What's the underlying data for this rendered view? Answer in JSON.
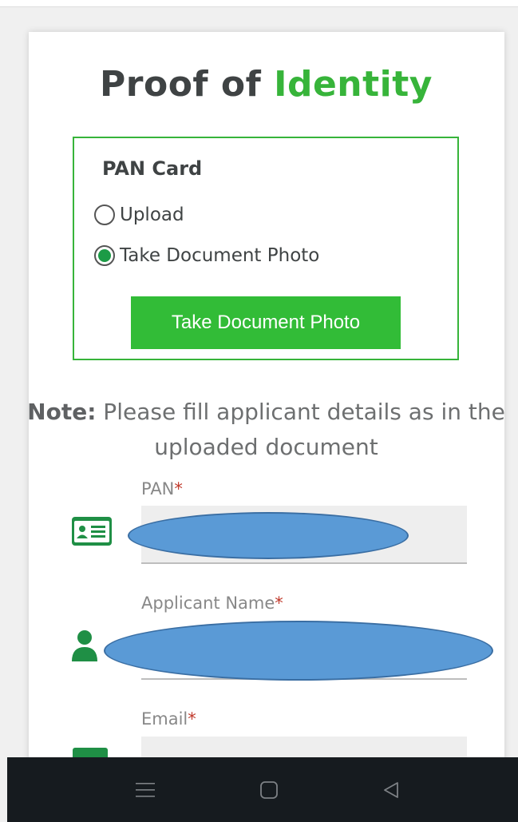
{
  "page": {
    "title_part1": "Proof of ",
    "title_part2": "Identity"
  },
  "pan_card": {
    "heading": "PAN Card",
    "options": [
      {
        "label": "Upload",
        "selected": false
      },
      {
        "label": "Take Document Photo",
        "selected": true
      }
    ],
    "button_label": "Take Document Photo"
  },
  "note": {
    "bold": "Note:",
    "text": " Please fill applicant details as in the uploaded document"
  },
  "fields": [
    {
      "label": "PAN",
      "required_mark": "*",
      "icon": "id-card-icon",
      "value": ""
    },
    {
      "label": "Applicant Name",
      "required_mark": "*",
      "icon": "user-icon",
      "value": ""
    },
    {
      "label": "Email",
      "required_mark": "*",
      "icon": "email-icon",
      "value": ""
    }
  ],
  "colors": {
    "accent_green": "#37b43a",
    "button_green": "#32bc37",
    "icon_green": "#1f8f45",
    "redaction_blue": "#5a9ad6",
    "navbar": "#161b1f"
  },
  "navbar": {
    "buttons": [
      "menu-icon",
      "home-icon",
      "back-icon"
    ]
  }
}
